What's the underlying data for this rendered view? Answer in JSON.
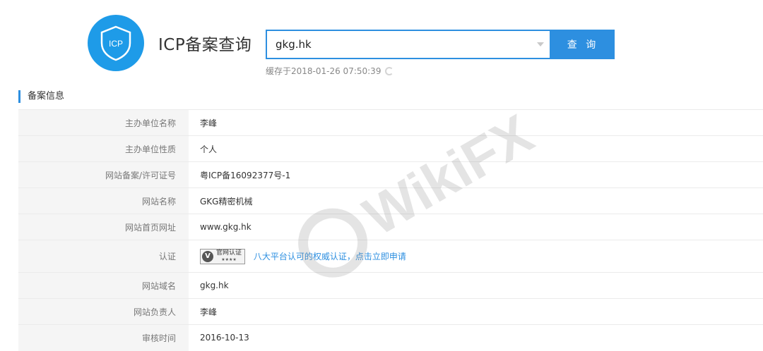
{
  "header": {
    "logo_text": "ICP",
    "title": "ICP备案查询"
  },
  "search": {
    "value": "gkg.hk",
    "button_label": "查 询",
    "cache_text": "缓存于2018-01-26 07:50:39"
  },
  "section": {
    "title": "备案信息"
  },
  "rows": [
    {
      "label": "主办单位名称",
      "value": "李峰"
    },
    {
      "label": "主办单位性质",
      "value": "个人"
    },
    {
      "label": "网站备案/许可证号",
      "value": "粤ICP备16092377号-1"
    },
    {
      "label": "网站名称",
      "value": "GKG精密机械"
    },
    {
      "label": "网站首页网址",
      "value": "www.gkg.hk"
    },
    {
      "label": "认证",
      "value": ""
    },
    {
      "label": "网站域名",
      "value": "gkg.hk"
    },
    {
      "label": "网站负责人",
      "value": "李峰"
    },
    {
      "label": "审核时间",
      "value": "2016-10-13"
    }
  ],
  "certification": {
    "badge_letter": "V",
    "badge_text": "官网认证",
    "badge_stars": "★★★★",
    "link_text": "八大平台认可的权威认证，点击立即申请"
  },
  "watermark": {
    "text": "WikiFX"
  },
  "colors": {
    "accent": "#2d8fe0",
    "logo": "#1e9be8"
  }
}
